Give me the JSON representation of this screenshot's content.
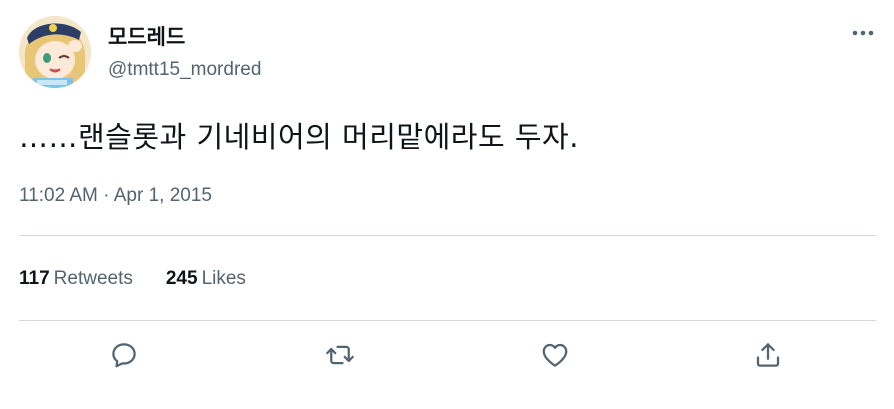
{
  "author": {
    "display_name": "모드레드",
    "handle": "@tmtt15_mordred",
    "avatar_icon": "anime-avatar"
  },
  "tweet": {
    "text": "……랜슬롯과 기네비어의 머리맡에라도 두자.",
    "time": "11:02 AM",
    "separator": " · ",
    "date": "Apr 1, 2015"
  },
  "stats": {
    "retweets_count": "117",
    "retweets_label": "Retweets",
    "likes_count": "245",
    "likes_label": "Likes"
  },
  "icons": {
    "more": "more-horizontal-icon",
    "reply": "reply-icon",
    "retweet": "retweet-icon",
    "like": "heart-icon",
    "share": "share-icon"
  },
  "colors": {
    "text_primary": "#0f1419",
    "text_secondary": "#536471",
    "divider": "#cfd9de",
    "background": "#ffffff"
  }
}
